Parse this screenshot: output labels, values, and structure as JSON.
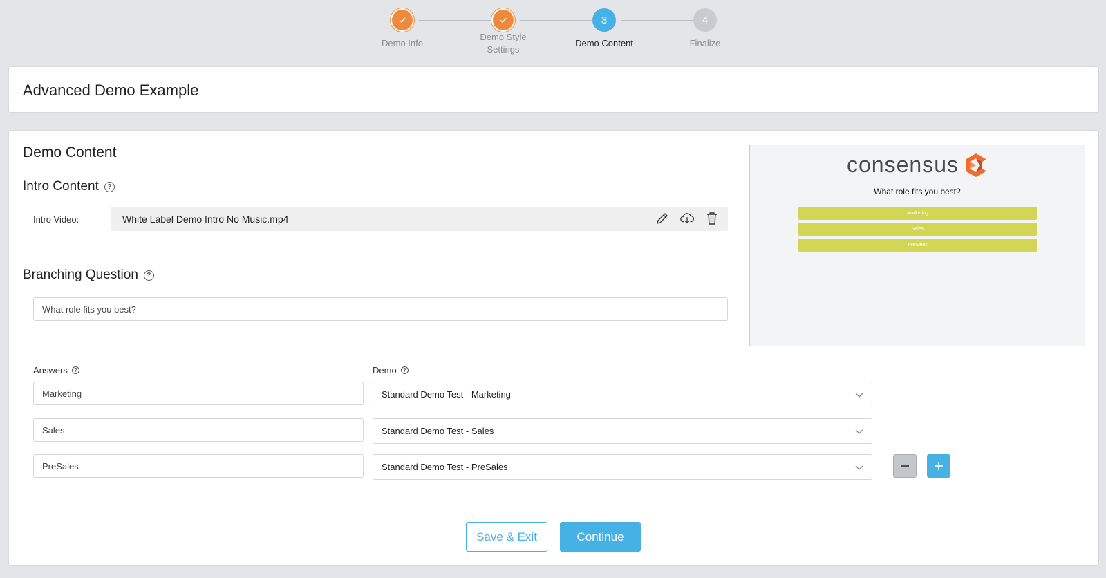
{
  "stepper": {
    "steps": [
      {
        "label": "Demo Info",
        "state": "done"
      },
      {
        "label": "Demo Style Settings",
        "label_line1": "Demo Style",
        "label_line2": "Settings",
        "state": "done"
      },
      {
        "label": "Demo Content",
        "number": "3",
        "state": "active"
      },
      {
        "label": "Finalize",
        "number": "4",
        "state": "todo"
      }
    ]
  },
  "page_title": "Advanced Demo Example",
  "content": {
    "section_title": "Demo Content",
    "intro": {
      "title": "Intro Content",
      "video_label": "Intro Video:",
      "video_file": "White Label Demo Intro No Music.mp4",
      "actions": [
        "pencil-icon",
        "cloud-download-icon",
        "trash-icon"
      ]
    },
    "branching": {
      "title": "Branching Question",
      "question_value": "What role fits you best?"
    },
    "answers_label": "Answers",
    "demo_label": "Demo",
    "rows": [
      {
        "answer": "Marketing",
        "demo": "Standard Demo Test - Marketing"
      },
      {
        "answer": "Sales",
        "demo": "Standard Demo Test - Sales"
      },
      {
        "answer": "PreSales",
        "demo": "Standard Demo Test - PreSales"
      }
    ],
    "buttons": {
      "save_exit": "Save & Exit",
      "continue": "Continue"
    }
  },
  "preview": {
    "logo_text": "consensus",
    "question": "What role fits you best?",
    "answers": [
      "Marketing",
      "Sales",
      "PreSales"
    ],
    "answer_color": "#d1d654",
    "logo_color": "#f26a2e"
  },
  "colors": {
    "accent": "#46b1e4",
    "done": "#ef8a3c",
    "background": "#e4e5e8"
  }
}
